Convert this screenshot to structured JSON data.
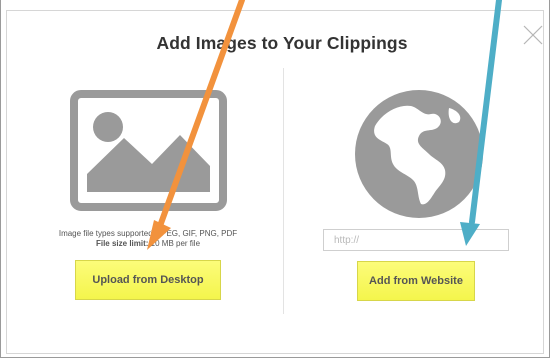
{
  "dialog": {
    "title": "Add Images to Your Clippings"
  },
  "upload": {
    "icon": "image-placeholder-icon",
    "supported_line": "Image file types supported: JPEG, GIF, PNG, PDF",
    "size_label": "File size limit:",
    "size_value": "10 MB per file",
    "button_label": "Upload from Desktop"
  },
  "website": {
    "icon": "globe-icon",
    "url_placeholder": "http://",
    "button_label": "Add from Website"
  },
  "colors": {
    "button_yellow": "#f7f75e",
    "icon_gray": "#9a9a9a",
    "arrow_orange": "#f2923d",
    "arrow_blue": "#4eaec7"
  }
}
